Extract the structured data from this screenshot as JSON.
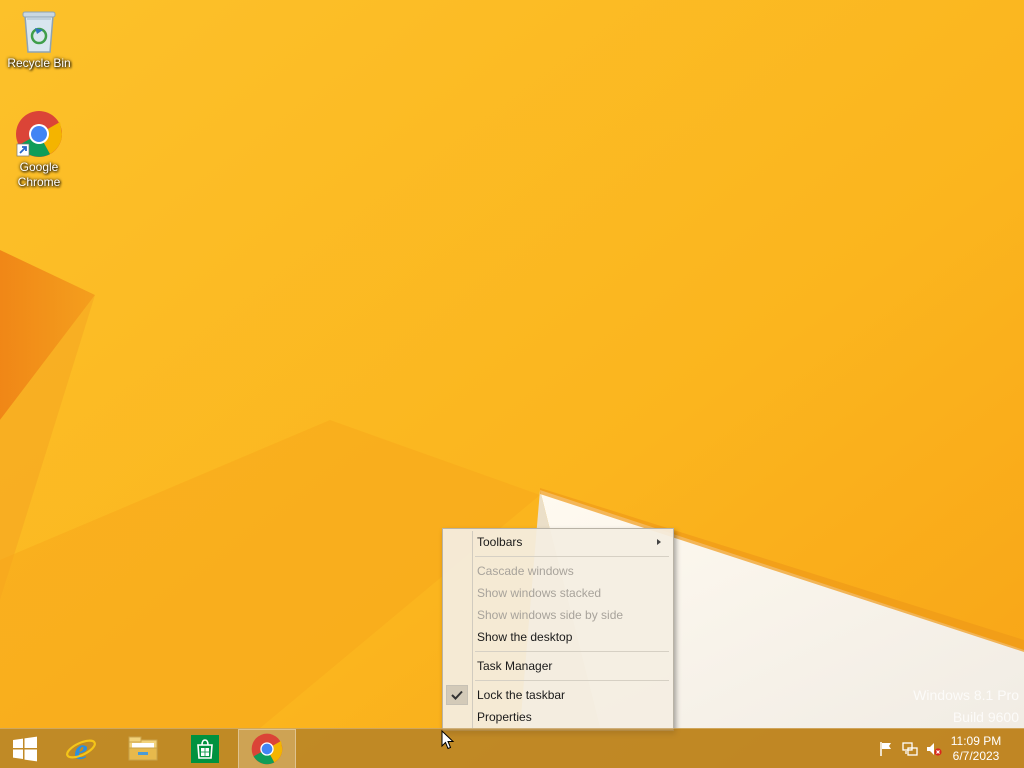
{
  "desktop": {
    "icons": [
      {
        "label": "Recycle Bin",
        "icon": "recycle-bin-icon"
      },
      {
        "label": "Google Chrome",
        "icon": "chrome-icon"
      }
    ],
    "watermark": {
      "line1": "Windows 8.1 Pro",
      "line2": "Build 9600"
    }
  },
  "context_menu": {
    "items": [
      {
        "label": "Toolbars",
        "enabled": true,
        "submenu": true
      },
      {
        "label": "Cascade windows",
        "enabled": false
      },
      {
        "label": "Show windows stacked",
        "enabled": false
      },
      {
        "label": "Show windows side by side",
        "enabled": false
      },
      {
        "label": "Show the desktop",
        "enabled": true
      },
      {
        "label": "Task Manager",
        "enabled": true
      },
      {
        "label": "Lock the taskbar",
        "enabled": true,
        "checked": true
      },
      {
        "label": "Properties",
        "enabled": true
      }
    ]
  },
  "taskbar": {
    "buttons": [
      {
        "icon": "windows-start-icon"
      },
      {
        "icon": "internet-explorer-icon"
      },
      {
        "icon": "file-explorer-icon"
      },
      {
        "icon": "windows-store-icon"
      },
      {
        "icon": "chrome-icon",
        "active": true
      }
    ],
    "tray": {
      "icons": [
        "action-center-flag-icon",
        "network-icon",
        "volume-muted-icon"
      ],
      "time": "11:09 PM",
      "date": "6/7/2023"
    }
  },
  "colors": {
    "wallpaper": "#fbbb22",
    "taskbar": "#b07e28",
    "menu_bg": "#f4eee2"
  }
}
